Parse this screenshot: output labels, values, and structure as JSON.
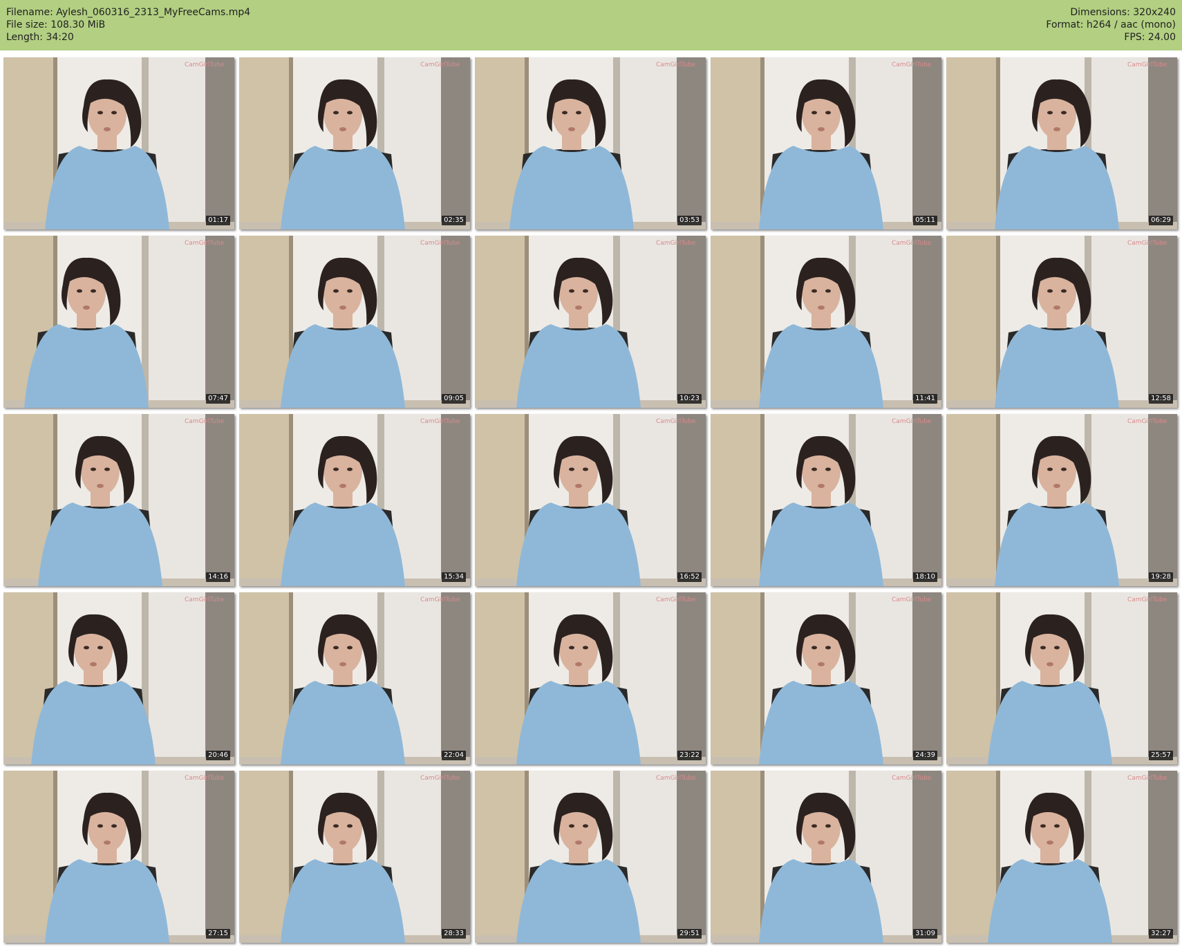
{
  "info": {
    "filename": "Filename: Aylesh_060316_2313_MyFreeCams.mp4",
    "filesize": "File size: 108.30 MiB",
    "length": "Length: 34:20",
    "dimensions": "Dimensions: 320x240",
    "format": "Format: h264 / aac (mono)",
    "fps": "FPS: 24.00"
  },
  "colors": {
    "header_bg": "#b2cf82",
    "shirt": "#8fb8d8",
    "hair": "#2b2220",
    "skin": "#d9b39e",
    "wall": "#e9e6e2",
    "wardrobe": "#cfc2a7"
  },
  "thumbnails": [
    {
      "time": "01:17"
    },
    {
      "time": "02:35"
    },
    {
      "time": "03:53"
    },
    {
      "time": "05:11"
    },
    {
      "time": "06:29"
    },
    {
      "time": "07:47"
    },
    {
      "time": "09:05"
    },
    {
      "time": "10:23"
    },
    {
      "time": "11:41"
    },
    {
      "time": "12:58"
    },
    {
      "time": "14:16"
    },
    {
      "time": "15:34"
    },
    {
      "time": "16:52"
    },
    {
      "time": "18:10"
    },
    {
      "time": "19:28"
    },
    {
      "time": "20:46"
    },
    {
      "time": "22:04"
    },
    {
      "time": "23:22"
    },
    {
      "time": "24:39"
    },
    {
      "time": "25:57"
    },
    {
      "time": "27:15"
    },
    {
      "time": "28:33"
    },
    {
      "time": "29:51"
    },
    {
      "time": "31:09"
    },
    {
      "time": "32:27"
    }
  ]
}
